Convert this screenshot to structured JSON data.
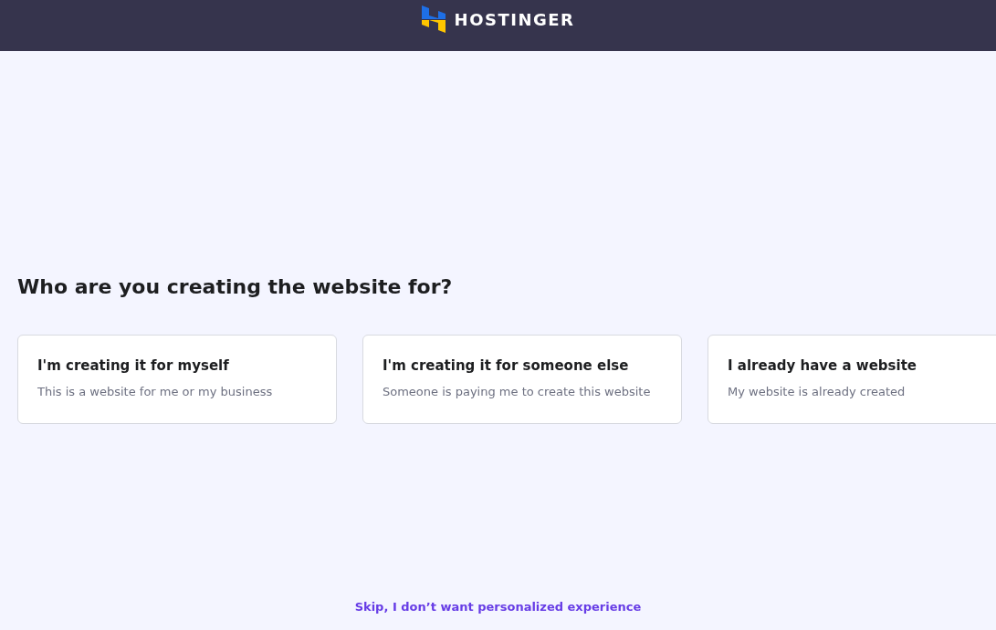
{
  "header": {
    "brand": "HOSTINGER"
  },
  "question": "Who are you creating the website for?",
  "options": [
    {
      "title": "I'm creating it for myself",
      "description": "This is a website for me or my business"
    },
    {
      "title": "I'm creating it for someone else",
      "description": "Someone is paying me to create this website"
    },
    {
      "title": "I already have a website",
      "description": "My website is already created"
    }
  ],
  "skip_link": "Skip, I don’t want personalized experience"
}
